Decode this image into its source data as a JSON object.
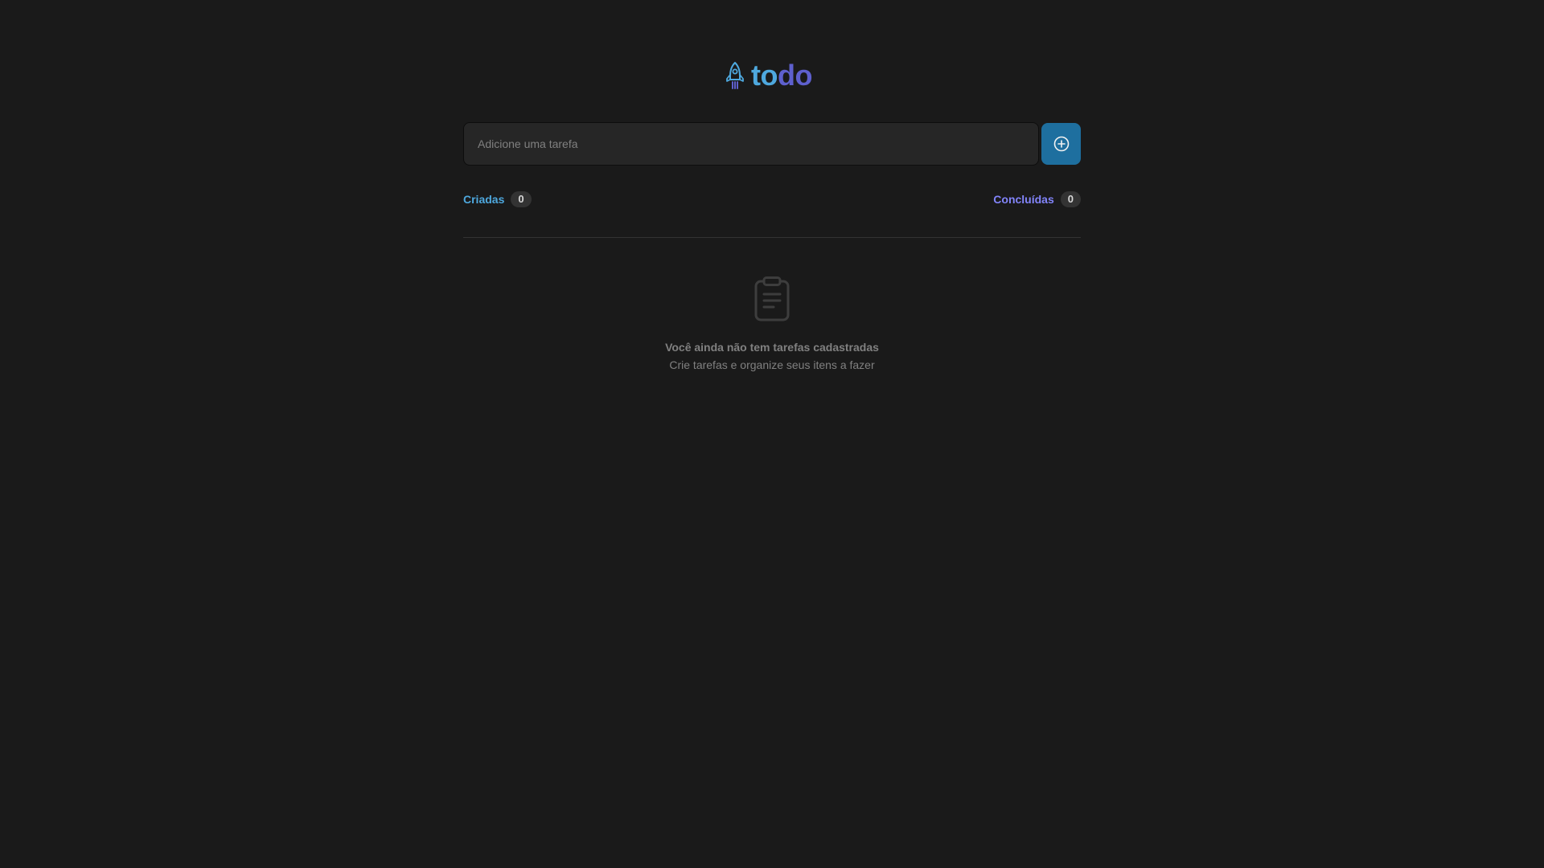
{
  "logo": {
    "part1": "to",
    "part2": "do",
    "icon": "rocket-icon",
    "colors": {
      "part1": "#4ea8de",
      "part2": "#5e60ce"
    }
  },
  "new_task": {
    "placeholder": "Adicione uma tarefa",
    "value": "",
    "button_icon": "plus-circle-icon"
  },
  "counters": {
    "created": {
      "label": "Criadas",
      "count": "0"
    },
    "done": {
      "label": "Concluídas",
      "count": "0"
    }
  },
  "empty_state": {
    "icon": "clipboard-icon",
    "title": "Você ainda não tem tarefas cadastradas",
    "subtitle": "Crie tarefas e organize seus itens a fazer"
  },
  "colors": {
    "background": "#1a1a1a",
    "input_bg": "#262626",
    "button": "#1e6f9f",
    "blue": "#4ea8de",
    "purple": "#8284fa",
    "muted_text": "#808080"
  }
}
